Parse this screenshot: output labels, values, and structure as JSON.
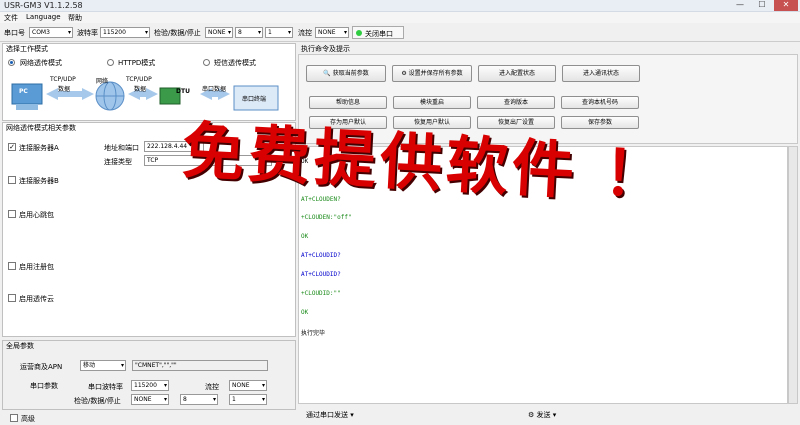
{
  "window": {
    "title": "USR-GM3 V1.1.2.58",
    "minimize": "—",
    "maximize": "☐",
    "close": "✕"
  },
  "menu": {
    "file": "文件",
    "language": "Language",
    "help": "帮助"
  },
  "toolbar": {
    "port_label": "串口号",
    "port_value": "COM3",
    "baud_label": "波特率",
    "baud_value": "115200",
    "parity_label": "检验/数据/停止",
    "parity_value": "NONE",
    "data_value": "8",
    "stop_value": "1",
    "flow_label": "流控",
    "flow_value": "NONE",
    "close_port_label": "关闭串口",
    "status_color": "#2ecc40"
  },
  "left": {
    "work_mode_title": "选择工作模式",
    "modes": [
      "网络透传模式",
      "HTTPD模式",
      "短信透传模式"
    ],
    "diagram": {
      "pc": "PC",
      "tcp_udp_1": "TCP/UDP",
      "data_1": "数据",
      "network": "网络",
      "tcp_udp_2": "TCP/UDP",
      "data_2": "数据",
      "dtu": "DTU",
      "serial_data": "串口数据",
      "serial_device": "串口终端"
    },
    "net_params_title": "网络透传模式相关参数",
    "server_a": "连接服务器A",
    "addr_port_label": "地址和端口",
    "addr_value": "222.128.4.44",
    "conn_type_label": "连接类型",
    "conn_type_value": "TCP",
    "server_b": "连接服务器B",
    "heartbeat": "启用心跳包",
    "register": "启用注册包",
    "cloud": "启用透传云",
    "global_title": "全局参数",
    "apn_label": "运营商及APN",
    "apn_op": "移动",
    "apn_value": "\"CMNET\",\"\",\"\"",
    "serial_params_label": "串口参数",
    "serial_baud_label": "串口波特率",
    "serial_baud_value": "115200",
    "serial_flow_label": "流控",
    "serial_flow_value": "NONE",
    "serial_parity_label": "检验/数据/停止",
    "serial_parity_value": "NONE",
    "serial_data_value": "8",
    "serial_stop_value": "1",
    "advanced": "高级"
  },
  "right": {
    "title": "执行命令及提示",
    "buttons": {
      "get_params": "获取当前参数",
      "set_save": "设置并保存所有参数",
      "enter_config": "进入配置状态",
      "enter_comm": "进入通讯状态",
      "help": "帮助信息",
      "restart": "模块重启",
      "query_version": "查询版本",
      "query_number": "查询本机号码",
      "save_default": "存为用户默认",
      "restore_user": "恢复用户默认",
      "restore_factory": "恢复出厂设置",
      "save_params": "保存参数"
    },
    "log": [
      "OK",
      "AT+CLOUDEN?",
      "+CLOUDEN:\"off\"",
      "OK",
      "AT+CLOUDID?",
      "AT+CLOUDID?",
      "+CLOUDID:\"\"",
      "OK",
      "执行完毕"
    ],
    "send_via": "通过串口发送",
    "send": "发送"
  },
  "overlay_text": "免费提供软件  ！"
}
